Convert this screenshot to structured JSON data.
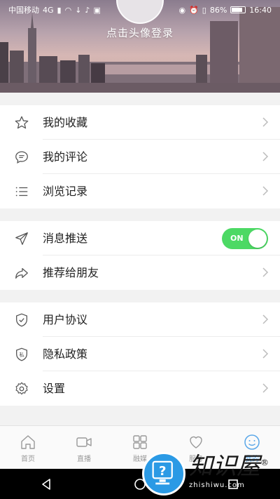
{
  "status_bar": {
    "carrier": "中国移动",
    "network": "4G",
    "battery": "86%",
    "battery_level": 0.86,
    "time": "16:40"
  },
  "header": {
    "login_prompt": "点击头像登录"
  },
  "groups": [
    {
      "items": [
        {
          "label": "我的收藏",
          "icon": "star-icon"
        },
        {
          "label": "我的评论",
          "icon": "comment-icon"
        },
        {
          "label": "浏览记录",
          "icon": "history-list-icon"
        }
      ]
    },
    {
      "items": [
        {
          "label": "消息推送",
          "icon": "send-icon",
          "toggle": "ON"
        },
        {
          "label": "推荐给朋友",
          "icon": "share-icon"
        }
      ]
    },
    {
      "items": [
        {
          "label": "用户协议",
          "icon": "shield-check-icon"
        },
        {
          "label": "隐私政策",
          "icon": "privacy-shield-icon",
          "icon_text": "私"
        },
        {
          "label": "设置",
          "icon": "gear-icon"
        }
      ]
    }
  ],
  "tabbar": {
    "tabs": [
      {
        "label": "首页",
        "icon": "home-icon"
      },
      {
        "label": "直播",
        "icon": "video-camera-icon"
      },
      {
        "label": "融媒",
        "icon": "grid-icon"
      },
      {
        "label": "服务",
        "icon": "heart-icon"
      },
      {
        "label": "我的",
        "icon": "smiley-icon",
        "active": true
      }
    ]
  },
  "watermark": {
    "title": "知识屋",
    "registered": "®",
    "site": "zhishiwu.com"
  },
  "colors": {
    "toggle_on": "#4cd964",
    "active_tab": "#5aa7e8"
  }
}
